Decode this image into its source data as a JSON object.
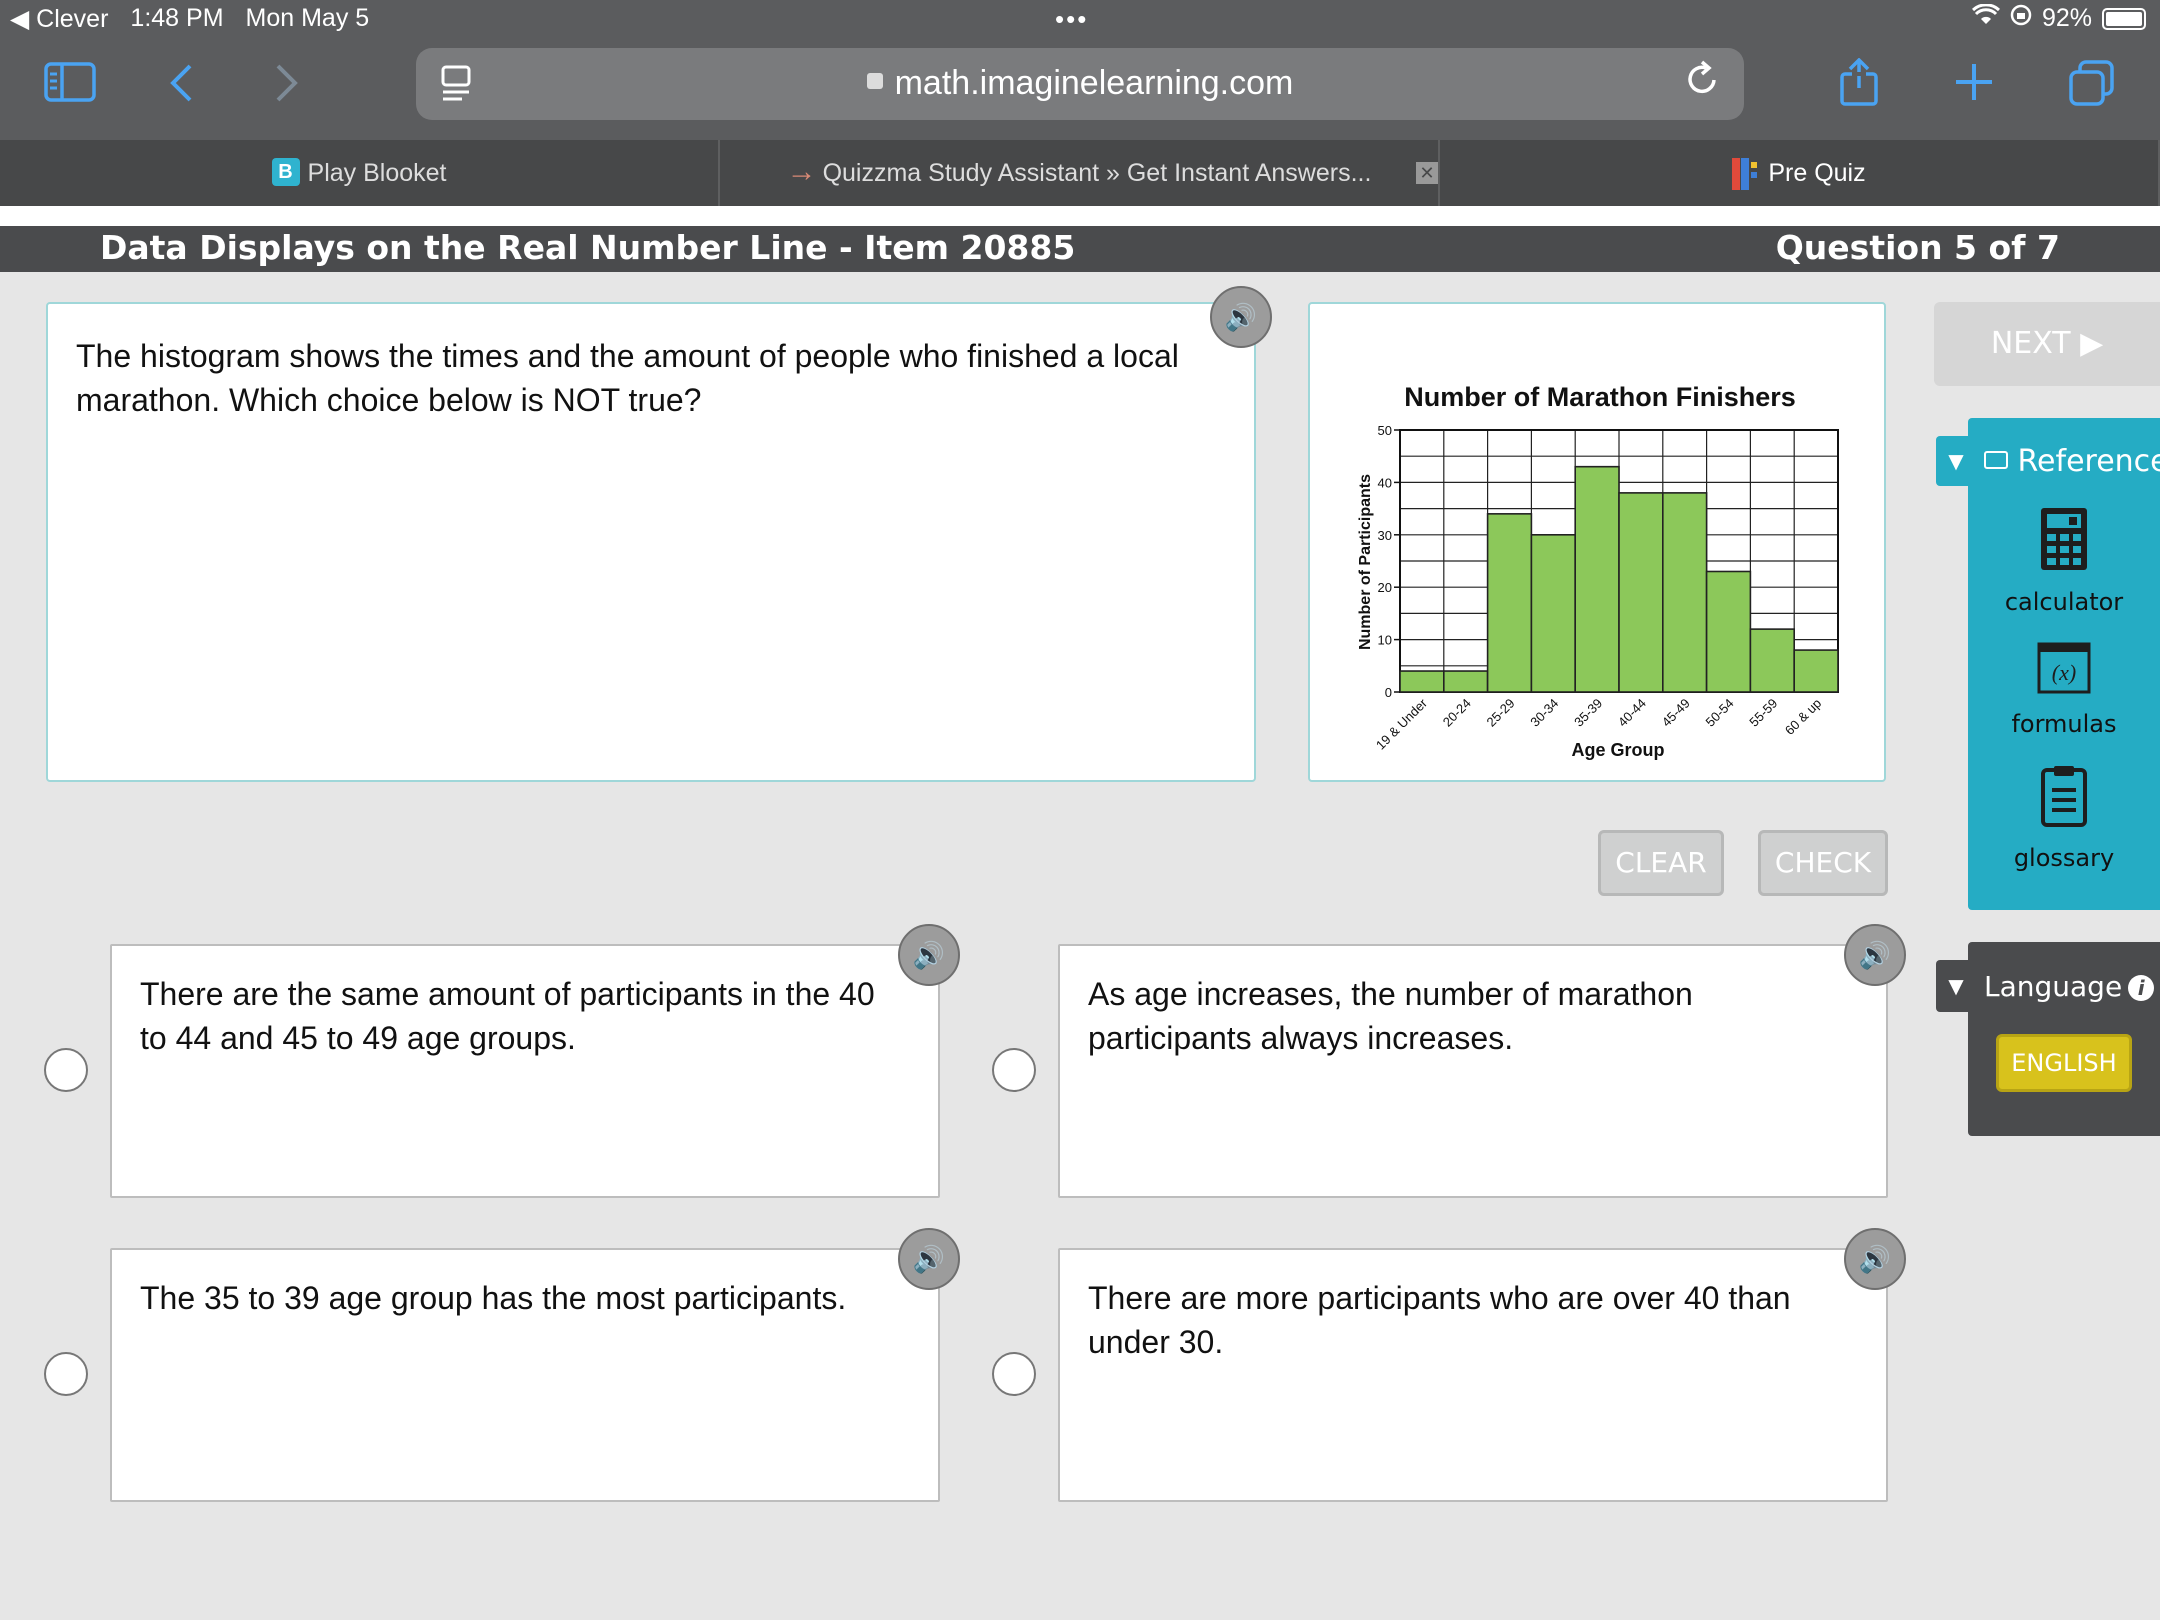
{
  "status_bar": {
    "back_app": "◀ Clever",
    "time": "1:48 PM",
    "date": "Mon May 5",
    "dots": "•••",
    "battery": "92%"
  },
  "browser": {
    "url": "math.imaginelearning.com",
    "tabs": [
      {
        "label": "Play Blooket",
        "favicon": "B",
        "favicon_color": "#2fb3cf"
      },
      {
        "label": "Quizzma Study Assistant » Get Instant Answers...",
        "favicon": "→",
        "favicon_color": "#474849"
      },
      {
        "label": "Pre Quiz",
        "favicon": "",
        "favicon_color": "#e04a3b"
      }
    ]
  },
  "lesson": {
    "title": "Data Displays on the Real Number Line - Item 20885",
    "question_counter": "Question 5 of 7"
  },
  "question": {
    "text": "The histogram shows the times and the amount of people who finished a local marathon. Which choice below is NOT true?"
  },
  "buttons": {
    "clear": "CLEAR",
    "check": "CHECK",
    "next": "NEXT ▶"
  },
  "answers": [
    {
      "text": "There are the same amount of participants in the 40 to 44 and 45 to 49 age groups."
    },
    {
      "text": "As age increases, the number of marathon participants always increases."
    },
    {
      "text": "The 35 to 39 age group has the most participants."
    },
    {
      "text": "There are more participants who are over 40 than under 30."
    }
  ],
  "reference": {
    "title": "Reference",
    "items": [
      {
        "label": "calculator",
        "icon": "calculator-icon"
      },
      {
        "label": "formulas",
        "icon": "formulas-icon"
      },
      {
        "label": "glossary",
        "icon": "glossary-icon"
      }
    ],
    "formulas_glyph": "(x)"
  },
  "language": {
    "title": "Language",
    "english": "ENGLISH"
  },
  "colors": {
    "bar_fill": "#8cc85a",
    "accent_teal": "#25acc4",
    "english_yellow": "#d8c21c"
  },
  "chart_data": {
    "type": "bar",
    "title": "Number of Marathon Finishers",
    "xlabel": "Age Group",
    "ylabel": "Number of Participants",
    "categories": [
      "19 & Under",
      "20-24",
      "25-29",
      "30-34",
      "35-39",
      "40-44",
      "45-49",
      "50-54",
      "55-59",
      "60 & up"
    ],
    "values": [
      4,
      4,
      34,
      30,
      43,
      38,
      38,
      23,
      12,
      8
    ],
    "ylim": [
      0,
      50
    ],
    "yticks": [
      0,
      10,
      20,
      30,
      40,
      50
    ],
    "grid": true
  }
}
